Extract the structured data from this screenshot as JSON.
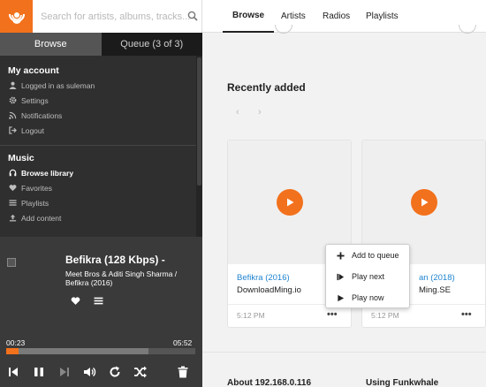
{
  "search": {
    "placeholder": "Search for artists, albums, tracks..."
  },
  "sidebar_tabs": {
    "browse": "Browse",
    "queue": "Queue (3 of 3)"
  },
  "account": {
    "title": "My account",
    "items": [
      {
        "label": "Logged in as suleman",
        "icon": "user-icon"
      },
      {
        "label": "Settings",
        "icon": "gear-icon"
      },
      {
        "label": "Notifications",
        "icon": "rss-icon"
      },
      {
        "label": "Logout",
        "icon": "logout-icon"
      }
    ]
  },
  "music": {
    "title": "Music",
    "items": [
      {
        "label": "Browse library",
        "icon": "headphones-icon"
      },
      {
        "label": "Favorites",
        "icon": "heart-icon"
      },
      {
        "label": "Playlists",
        "icon": "list-icon"
      },
      {
        "label": "Add content",
        "icon": "upload-icon"
      }
    ]
  },
  "player": {
    "title": "Befikra (128 Kbps) -",
    "artist": "Meet Bros & Aditi Singh Sharma  /",
    "album": "Befikra (2016)",
    "current_time": "00:23",
    "duration": "05:52",
    "progress": 0.065,
    "buffered": 0.75
  },
  "menu": {
    "browse": "Browse",
    "artists": "Artists",
    "radios": "Radios",
    "playlists": "Playlists"
  },
  "recently_added": {
    "title": "Recently added",
    "prev": "‹",
    "next": "›",
    "cards": [
      {
        "title": "Befikra (2016)",
        "artist": "DownloadMing.io",
        "time": "5:12 PM",
        "more": "•••"
      },
      {
        "title": "an (2018)",
        "artist": "Ming.SE",
        "time": "5:12 PM",
        "more": "•••"
      }
    ]
  },
  "context_menu": {
    "items": [
      {
        "label": "Add to queue",
        "icon": "plus-icon"
      },
      {
        "label": "Play next",
        "icon": "step-forward-icon"
      },
      {
        "label": "Play now",
        "icon": "play-icon"
      }
    ]
  },
  "footer": {
    "about": "About 192.168.0.116",
    "using": "Using Funkwhale"
  },
  "colors": {
    "accent": "#f2711c",
    "link": "#2185d0",
    "sidebar": "#2f2f2f"
  }
}
